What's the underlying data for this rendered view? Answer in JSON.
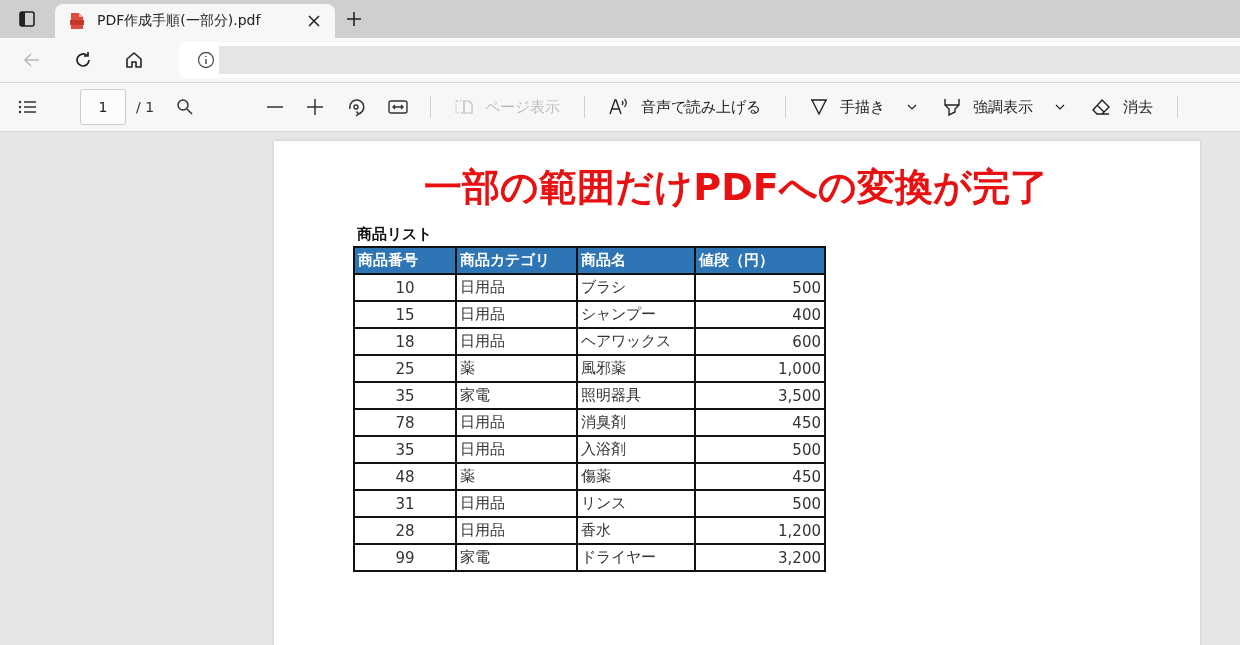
{
  "tab": {
    "title": "PDF作成手順(一部分).pdf",
    "selected": true
  },
  "toolbar": {
    "page_number": "1",
    "page_count": "/ 1",
    "tools": [
      {
        "label": "ページ表示",
        "disabled": true,
        "dropdown": false
      },
      {
        "label": "音声で読み上げる",
        "disabled": false,
        "dropdown": false
      },
      {
        "label": "手描き",
        "disabled": false,
        "dropdown": true
      },
      {
        "label": "強調表示",
        "disabled": false,
        "dropdown": true
      },
      {
        "label": "消去",
        "disabled": false,
        "dropdown": false
      }
    ]
  },
  "document": {
    "heading": "一部の範囲だけPDFへの変換が完了",
    "table_title": "商品リスト",
    "columns": [
      "商品番号",
      "商品カテゴリ",
      "商品名",
      "値段（円）"
    ],
    "rows": [
      [
        "10",
        "日用品",
        "ブラシ",
        "500"
      ],
      [
        "15",
        "日用品",
        "シャンプー",
        "400"
      ],
      [
        "18",
        "日用品",
        "ヘアワックス",
        "600"
      ],
      [
        "25",
        "薬",
        "風邪薬",
        "1,000"
      ],
      [
        "35",
        "家電",
        "照明器具",
        "3,500"
      ],
      [
        "78",
        "日用品",
        "消臭剤",
        "450"
      ],
      [
        "35",
        "日用品",
        "入浴剤",
        "500"
      ],
      [
        "48",
        "薬",
        "傷薬",
        "450"
      ],
      [
        "31",
        "日用品",
        "リンス",
        "500"
      ],
      [
        "28",
        "日用品",
        "香水",
        "1,200"
      ],
      [
        "99",
        "家電",
        "ドライヤー",
        "3,200"
      ]
    ]
  }
}
